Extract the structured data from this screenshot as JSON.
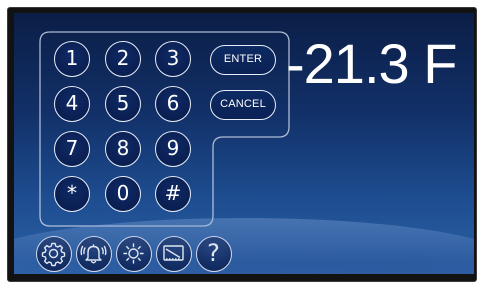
{
  "keypad": {
    "keys": [
      "1",
      "2",
      "3",
      "4",
      "5",
      "6",
      "7",
      "8",
      "9",
      "*",
      "0",
      "#"
    ],
    "enter_label": "ENTER",
    "cancel_label": "CANCEL"
  },
  "display": {
    "reading": "-21.3 F"
  },
  "toolbar": {
    "help_label": "?",
    "icons": [
      "settings-gear-icon",
      "alarm-bell-icon",
      "brightness-sun-icon",
      "display-screen-icon",
      "help-icon"
    ]
  },
  "colors": {
    "screen_top": "#0b1e47",
    "screen_bottom": "#2c61a6",
    "key_fill": "#0a1f52",
    "outline": "#e8eef8",
    "text": "#ffffff"
  }
}
